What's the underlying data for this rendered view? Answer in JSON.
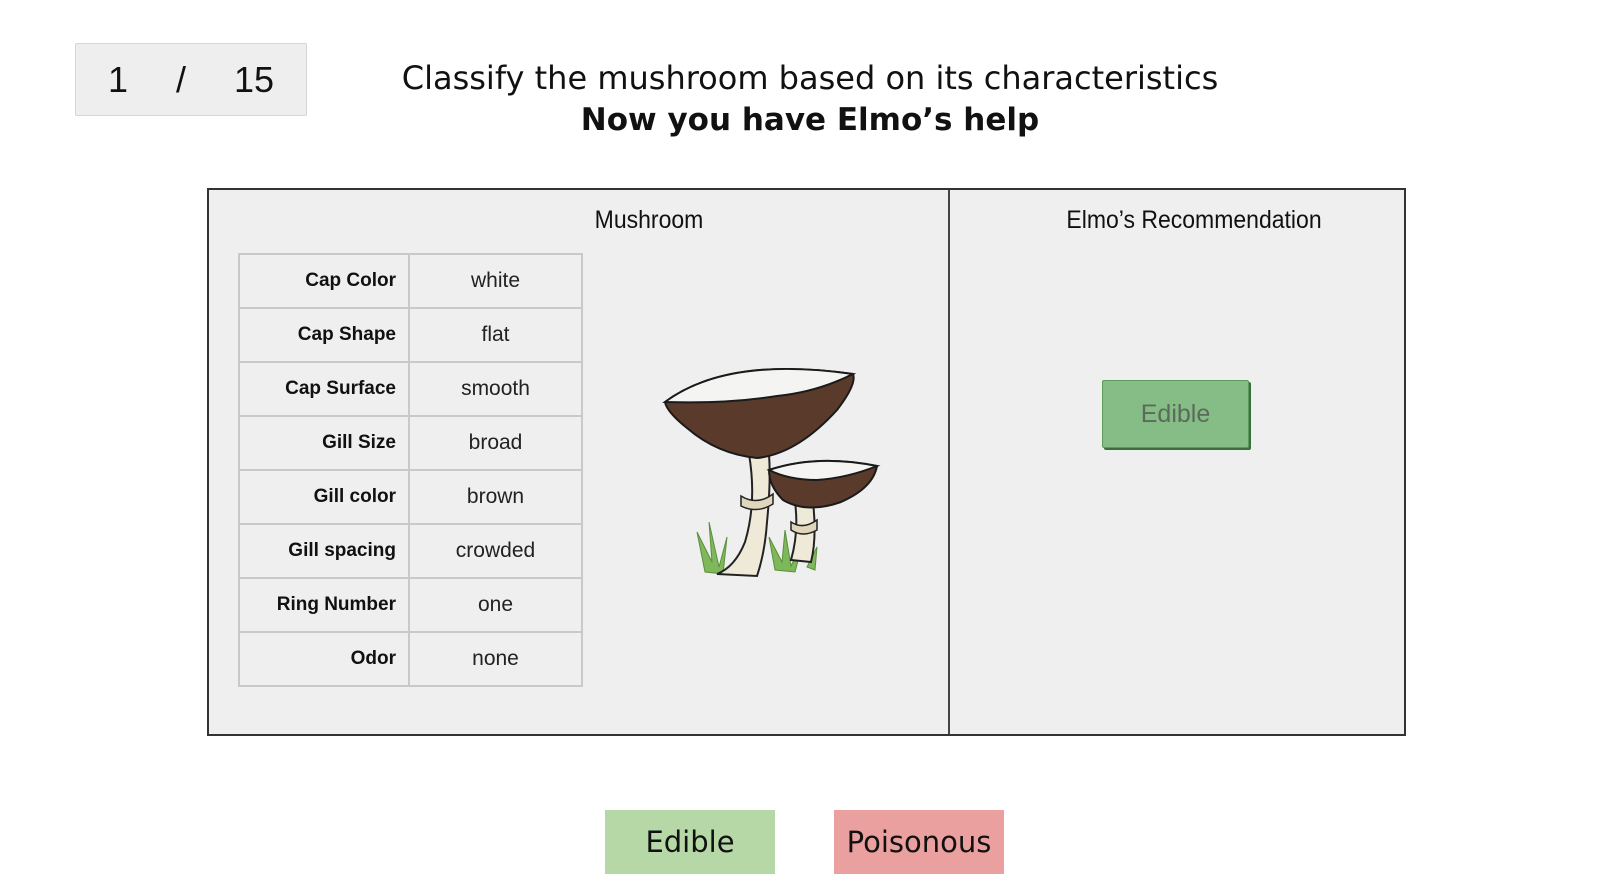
{
  "progress": {
    "current": "1",
    "separator": "/",
    "total": "15"
  },
  "header": {
    "instruction": "Classify the mushroom based on its characteristics",
    "subtitle": "Now you have Elmo’s help"
  },
  "mushroom_panel": {
    "title": "Mushroom",
    "attributes": [
      {
        "label": "Cap Color",
        "value": "white"
      },
      {
        "label": "Cap Shape",
        "value": "flat"
      },
      {
        "label": "Cap Surface",
        "value": "smooth"
      },
      {
        "label": "Gill Size",
        "value": "broad"
      },
      {
        "label": "Gill color",
        "value": "brown"
      },
      {
        "label": "Gill spacing",
        "value": "crowded"
      },
      {
        "label": "Ring Number",
        "value": "one"
      },
      {
        "label": "Odor",
        "value": "none"
      }
    ],
    "image_icon": "mushroom-illustration"
  },
  "recommendation_panel": {
    "title": "Elmo’s Recommendation",
    "recommendation": "Edible"
  },
  "choices": {
    "edible": "Edible",
    "poisonous": "Poisonous"
  },
  "colors": {
    "edible_button": "#b5d8a6",
    "poisonous_button": "#eba0a0",
    "recommendation_button": "#86bd86",
    "panel_background": "#efefef"
  }
}
